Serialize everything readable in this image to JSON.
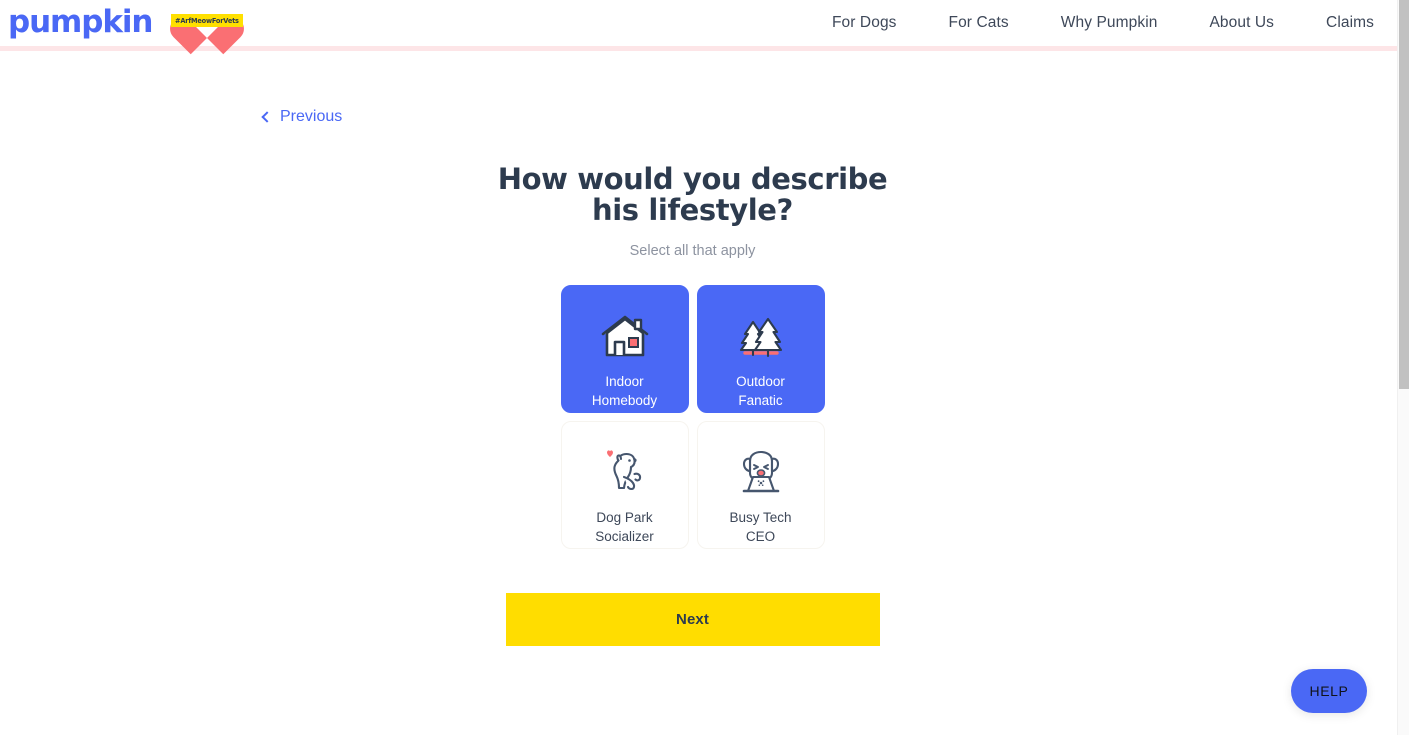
{
  "header": {
    "brand_name": "pumpkin",
    "badge_text": "#ArfMeowForVets",
    "nav": [
      {
        "label": "For Dogs"
      },
      {
        "label": "For Cats"
      },
      {
        "label": "Why Pumpkin"
      },
      {
        "label": "About Us"
      },
      {
        "label": "Claims"
      }
    ]
  },
  "main": {
    "previous_label": "Previous",
    "title": "How would you describe his lifestyle?",
    "subtitle": "Select all that apply",
    "options": [
      {
        "label": "Indoor\nHomebody",
        "icon": "house-icon",
        "selected": true
      },
      {
        "label": "Outdoor\nFanatic",
        "icon": "pine-trees-icon",
        "selected": true
      },
      {
        "label": "Dog Park\nSocializer",
        "icon": "sitting-dog-heart-icon",
        "selected": false
      },
      {
        "label": "Busy Tech\nCEO",
        "icon": "dog-laptop-icon",
        "selected": false
      }
    ],
    "next_label": "Next"
  },
  "help": {
    "label": "HELP"
  },
  "colors": {
    "brand_blue": "#4a68f5",
    "accent_yellow": "#ffdd00",
    "heart_red": "#fa6f73",
    "text_dark": "#2d3b4e",
    "header_border_pink": "#fde5e7"
  }
}
